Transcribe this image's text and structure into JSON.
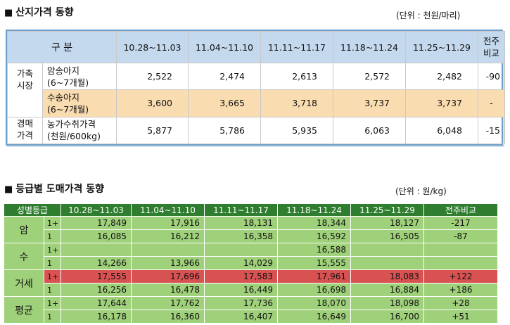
{
  "section1": {
    "title": "산지가격 동향",
    "unit": "(단위 : 천원/마리)",
    "header": {
      "gubun": "구 분",
      "periods": [
        "10.28~11.03",
        "11.04~11.10",
        "11.11~11.17",
        "11.18~11.24",
        "11.25~11.29"
      ],
      "compare_1": "전주",
      "compare_2": "비교"
    },
    "side_labels": {
      "a1": "가축",
      "a2": "시장",
      "b1": "경매",
      "b2": "가격"
    },
    "rows": [
      {
        "label1": "암송아지",
        "label2": "(6~7개월)",
        "values": [
          "2,522",
          "2,474",
          "2,613",
          "2,572",
          "2,482"
        ],
        "diff": "-90"
      },
      {
        "label1": "수송아지",
        "label2": "(6~7개월)",
        "values": [
          "3,600",
          "3,665",
          "3,718",
          "3,737",
          "3,737"
        ],
        "diff": "-"
      },
      {
        "label1": "농가수취가격",
        "label2": "(천원/600kg)",
        "values": [
          "5,877",
          "5,786",
          "5,935",
          "6,063",
          "6,048"
        ],
        "diff": "-15"
      }
    ]
  },
  "section2": {
    "title": "등급별 도매가격 동향",
    "unit": "(단위 : 원/kg)",
    "header": [
      "성별등급",
      "10.28~11.03",
      "11.04~11.10",
      "11.11~11.17",
      "11.18~11.24",
      "11.25~11.29",
      "전주비교"
    ],
    "groups": [
      {
        "name": "암",
        "rows": [
          {
            "grade": "1+",
            "values": [
              "17,849",
              "17,916",
              "18,131",
              "18,344",
              "18,127"
            ],
            "diff": "-217"
          },
          {
            "grade": "1",
            "values": [
              "16,085",
              "16,212",
              "16,358",
              "16,592",
              "16,505"
            ],
            "diff": "-87"
          }
        ]
      },
      {
        "name": "수",
        "rows": [
          {
            "grade": "1+",
            "values": [
              "",
              "",
              "",
              "16,588",
              ""
            ],
            "diff": ""
          },
          {
            "grade": "1",
            "values": [
              "14,266",
              "13,966",
              "14,029",
              "15,555",
              ""
            ],
            "diff": ""
          }
        ]
      },
      {
        "name": "거세",
        "rows": [
          {
            "grade": "1+",
            "values": [
              "17,555",
              "17,696",
              "17,583",
              "17,961",
              "18,083"
            ],
            "diff": "+122"
          },
          {
            "grade": "1",
            "values": [
              "16,256",
              "16,478",
              "16,449",
              "16,698",
              "16,884"
            ],
            "diff": "+186"
          }
        ]
      },
      {
        "name": "평균",
        "rows": [
          {
            "grade": "1+",
            "values": [
              "17,644",
              "17,762",
              "17,736",
              "18,070",
              "18,098"
            ],
            "diff": "+28"
          },
          {
            "grade": "1",
            "values": [
              "16,178",
              "16,360",
              "16,407",
              "16,649",
              "16,700"
            ],
            "diff": "+51"
          }
        ]
      }
    ]
  },
  "colors": {
    "table1_header": "#c5d9ee",
    "table1_border": "#6f9fc9",
    "table1_highlight_row": "#f9dcb0",
    "table2_header": "#2f7d2e",
    "table2_cell": "#9fd07a",
    "table2_highlight_row": "#d95252"
  }
}
